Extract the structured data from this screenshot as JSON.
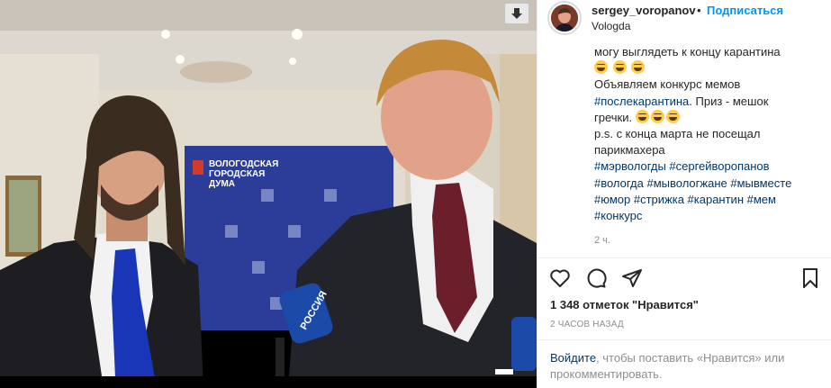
{
  "post": {
    "username": "sergey_voropanov",
    "separator": "•",
    "follow_label": "Подписаться",
    "location": "Vologda"
  },
  "photo": {
    "banner_lines": [
      "ВОЛОГОДСКАЯ",
      "ГОРОДСКАЯ",
      "ДУМА"
    ],
    "mic_label": "РОССИЯ"
  },
  "caption": {
    "line1": "могу выглядеть к концу карантина",
    "line3": "Объявляем конкурс мемов",
    "line4_tag": "#послекарантина",
    "line4_rest": ". Приз - мешок",
    "line5": "гречки.",
    "line6": "p.s. с конца марта не посещал",
    "line7": "парикмахера",
    "tags_line8": "#мэрвологды #сергейворопанов",
    "tags_line9": "#вологда #мывологжане #мывместе",
    "tags_line10": "#юмор #стрижка #карантин #мем",
    "tags_line11": "#конкурс",
    "time": "2 ч."
  },
  "actions": {
    "icons": [
      "heart-icon",
      "comment-icon",
      "share-icon",
      "bookmark-icon"
    ]
  },
  "stats": {
    "likes": "1 348 отметок \"Нравится\"",
    "posted": "2 ЧАСОВ НАЗАД"
  },
  "login": {
    "login_link": "Войдите",
    "rest": ", чтобы поставить «Нравится» или прокомментировать."
  },
  "colors": {
    "link": "#00376b",
    "follow": "#0095f6",
    "secondary": "#8e8e8e",
    "banner": "#2c3d99"
  }
}
